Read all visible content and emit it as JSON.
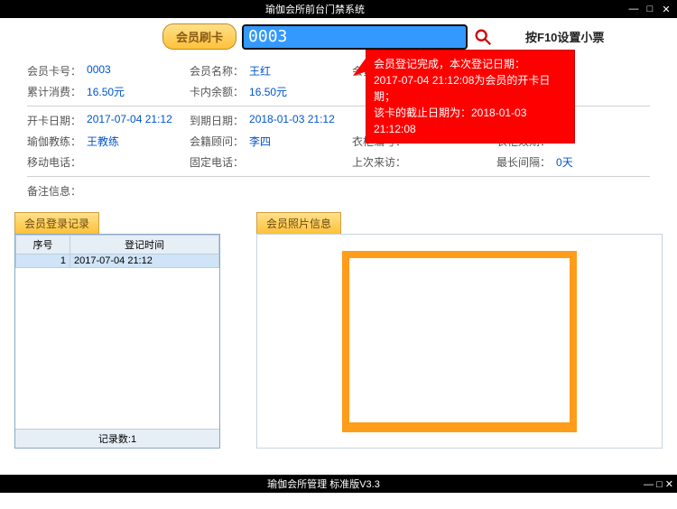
{
  "window": {
    "title": "瑜伽会所前台门禁系统"
  },
  "toolbar": {
    "swipe_label": "会员刷卡",
    "card_value": "0003",
    "f10_hint": "按F10设置小票"
  },
  "popup": {
    "line1": "会员登记完成，本次登记日期：",
    "line2": "2017-07-04 21:12:08为会员的开卡日期；",
    "line3": "该卡的截止日期为：2018-01-03 21:12:08"
  },
  "info": {
    "card_no_label": "会员卡号：",
    "card_no": "0003",
    "name_label": "会员名称：",
    "name": "王红",
    "member_x_label": "会员",
    "spend_label": "累计消费：",
    "spend": "16.50元",
    "balance_label": "卡内余额：",
    "balance": "16.50元",
    "open_label": "开卡日期：",
    "open": "2017-07-04 21:12",
    "expire_label": "到期日期：",
    "expire": "2018-01-03 21:12",
    "member_z_label": "会员",
    "coach_label": "瑜伽教练：",
    "coach": "王教练",
    "advisor_label": "会籍顾问：",
    "advisor": "李四",
    "locker_no_label": "衣柜编号：",
    "locker_no": "",
    "locker_exp_label": "衣柜效期：",
    "locker_exp": "",
    "mobile_label": "移动电话：",
    "mobile": "",
    "phone_label": "固定电话：",
    "phone": "",
    "last_visit_label": "上次来访：",
    "last_visit": "",
    "max_gap_label": "最长间隔：",
    "max_gap": "0天",
    "remark_label": "备注信息："
  },
  "login_panel": {
    "tab": "会员登录记录",
    "col_seq": "序号",
    "col_time": "登记时间",
    "rows": [
      {
        "seq": "1",
        "time": "2017-07-04 21:12"
      }
    ],
    "footer": "记录数:1"
  },
  "photo_panel": {
    "tab": "会员照片信息"
  },
  "bottom": {
    "title": "瑜伽会所管理 标准版V3.3"
  }
}
